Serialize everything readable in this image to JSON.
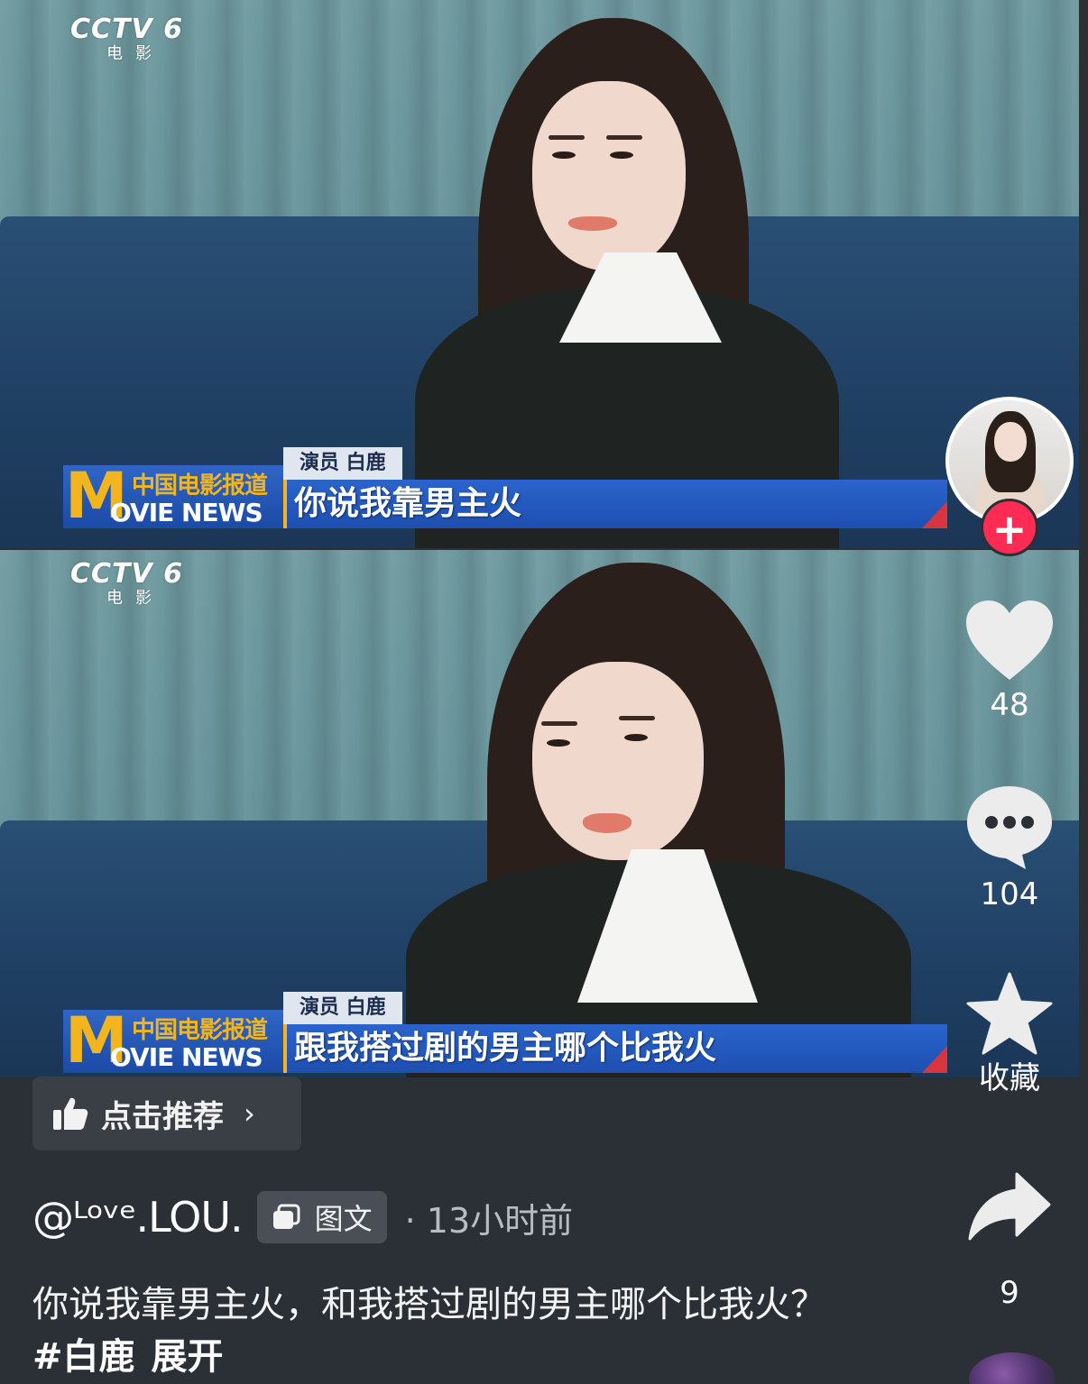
{
  "frames": [
    {
      "channel": "CCTV 6",
      "channel_sub": "电影",
      "program_cn": "中国电影报道",
      "program_en": "OVIE NEWS",
      "program_m": "M",
      "name_tag": "演员 白鹿",
      "caption": "你说我靠男主火"
    },
    {
      "channel": "CCTV 6",
      "channel_sub": "电影",
      "program_cn": "中国电影报道",
      "program_en": "OVIE NEWS",
      "program_m": "M",
      "name_tag": "演员 白鹿",
      "caption": "跟我搭过剧的男主哪个比我火"
    }
  ],
  "rail": {
    "follow_label": "+",
    "like_count": "48",
    "comment_count": "104",
    "favorite_label": "收藏",
    "share_count": "9",
    "icons": {
      "like": "heart-icon",
      "comment": "comment-bubble-icon",
      "favorite": "star-icon",
      "share": "share-arrow-icon"
    }
  },
  "recommend": {
    "label": "点击推荐",
    "chevron": "›"
  },
  "author": {
    "name": "@ᴸᵒᵛᵉ.LOU.",
    "type_badge": "图文",
    "time": "· 13小时前"
  },
  "description": {
    "text": "你说我靠男主火，和我搭过剧的男主哪个比我火？",
    "hashtag": "#白鹿",
    "expand": "展开"
  },
  "colors": {
    "background": "#2b2f36",
    "follow": "#fe2c55",
    "caption_bar": "#1e4fb0",
    "logo_gold": "#f2b51d"
  }
}
